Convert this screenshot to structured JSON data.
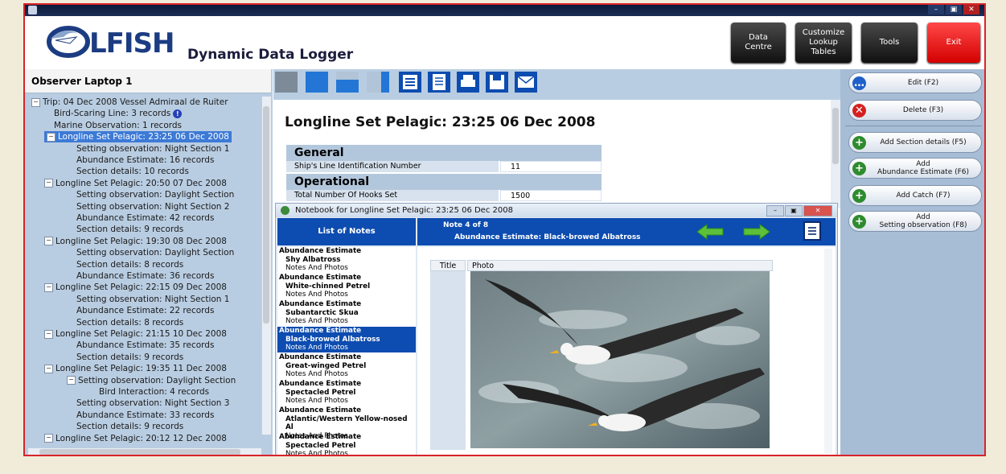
{
  "app": {
    "logo_text": "LFISH",
    "subtitle": "Dynamic Data Logger"
  },
  "header_buttons": [
    {
      "label": "Data\nCentre"
    },
    {
      "label": "Customize\nLookup\nTables"
    },
    {
      "label": "Tools"
    },
    {
      "label": "Exit"
    }
  ],
  "left_panel": {
    "title": "Observer Laptop 1",
    "tree": [
      {
        "text": "Trip: 04 Dec 2008 Vessel Admiraal de Ruiter",
        "level": 0,
        "expander": "−"
      },
      {
        "text": "Bird-Scaring Line: 3 records",
        "level": 1,
        "alert": "!"
      },
      {
        "text": "Marine Observation: 1 records",
        "level": 1
      },
      {
        "text": "Longline Set Pelagic: 23:25 06 Dec 2008",
        "level": 1,
        "expander": "−",
        "selected": true
      },
      {
        "text": "Setting observation: Night Section 1",
        "level": 2
      },
      {
        "text": "Abundance Estimate: 16 records",
        "level": 2
      },
      {
        "text": "Section details: 10 records",
        "level": 2
      },
      {
        "text": "Longline Set Pelagic: 20:50 07 Dec 2008",
        "level": 1,
        "expander": "−"
      },
      {
        "text": "Setting observation: Daylight Section",
        "level": 2
      },
      {
        "text": "Setting observation: Night Section 2",
        "level": 2
      },
      {
        "text": "Abundance Estimate: 42 records",
        "level": 2
      },
      {
        "text": "Section details: 9 records",
        "level": 2
      },
      {
        "text": "Longline Set Pelagic: 19:30 08 Dec 2008",
        "level": 1,
        "expander": "−"
      },
      {
        "text": "Setting observation: Daylight Section",
        "level": 2
      },
      {
        "text": "Section details: 8 records",
        "level": 2
      },
      {
        "text": "Abundance Estimate: 36 records",
        "level": 2
      },
      {
        "text": "Longline Set Pelagic: 22:15 09 Dec 2008",
        "level": 1,
        "expander": "−"
      },
      {
        "text": "Setting observation: Night Section 1",
        "level": 2
      },
      {
        "text": "Abundance Estimate: 22 records",
        "level": 2
      },
      {
        "text": "Section details: 8 records",
        "level": 2
      },
      {
        "text": "Longline Set Pelagic: 21:15 10 Dec 2008",
        "level": 1,
        "expander": "−"
      },
      {
        "text": "Abundance Estimate: 35 records",
        "level": 2
      },
      {
        "text": "Section details: 9 records",
        "level": 2
      },
      {
        "text": "Longline Set Pelagic: 19:35 11 Dec 2008",
        "level": 1,
        "expander": "−"
      },
      {
        "text": "Setting observation: Daylight Section",
        "level": 2,
        "expander": "−"
      },
      {
        "text": "Bird Interaction: 4 records",
        "level": 3
      },
      {
        "text": "Setting observation: Night Section 3",
        "level": 2
      },
      {
        "text": "Abundance Estimate: 33 records",
        "level": 2
      },
      {
        "text": "Section details: 9 records",
        "level": 2
      },
      {
        "text": "Longline Set Pelagic: 20:12 12 Dec 2008",
        "level": 1,
        "expander": "−"
      }
    ]
  },
  "detail": {
    "title": "Longline Set Pelagic: 23:25 06 Dec 2008",
    "general_label": "General",
    "operational_label": "Operational",
    "fields": [
      {
        "label": "Ship's Line Identification Number",
        "value": "11"
      },
      {
        "label": "Total Number Of Hooks Set",
        "value": "1500"
      }
    ]
  },
  "notebook": {
    "title": "Notebook for Longline Set Pelagic: 23:25 06 Dec 2008",
    "list_header": "List of Notes",
    "note_num": "Note 4 of 8",
    "note_title": "Abundance Estimate: Black-browed Albatross",
    "col_title": "Title",
    "col_photo": "Photo",
    "notes": [
      {
        "type": "Abundance Estimate",
        "species": "Shy Albatross",
        "sub": "Notes And Photos"
      },
      {
        "type": "Abundance Estimate",
        "species": "White-chinned Petrel",
        "sub": "Notes And Photos"
      },
      {
        "type": "Abundance Estimate",
        "species": "Subantarctic Skua",
        "sub": "Notes And Photos"
      },
      {
        "type": "Abundance Estimate",
        "species": "Black-browed Albatross",
        "sub": "Notes And Photos",
        "selected": true
      },
      {
        "type": "Abundance Estimate",
        "species": "Great-winged Petrel",
        "sub": "Notes And Photos"
      },
      {
        "type": "Abundance Estimate",
        "species": "Spectacled Petrel",
        "sub": "Notes And Photos"
      },
      {
        "type": "Abundance Estimate",
        "species": "Atlantic/Western Yellow-nosed Al",
        "sub": "Notes And Photos"
      },
      {
        "type": "Abundance Estimate",
        "species": "Spectacled Petrel",
        "sub": "Notes And Photos"
      }
    ]
  },
  "right_panel": {
    "buttons": [
      {
        "label": "Edit (F2)",
        "icon": "ellipsis-icon",
        "color": "#1f5fc8",
        "glyph": "…"
      },
      {
        "label": "Delete (F3)",
        "icon": "delete-icon",
        "color": "#d42020",
        "glyph": "✕"
      },
      {
        "label": "Add Section details (F5)",
        "icon": "add-icon",
        "color": "#2e8b2e",
        "glyph": "+"
      },
      {
        "label": "Add\nAbundance Estimate (F6)",
        "icon": "add-icon",
        "color": "#2e8b2e",
        "glyph": "+"
      },
      {
        "label": "Add Catch (F7)",
        "icon": "add-icon",
        "color": "#2e8b2e",
        "glyph": "+"
      },
      {
        "label": "Add\nSetting observation (F8)",
        "icon": "add-icon",
        "color": "#2e8b2e",
        "glyph": "+"
      }
    ]
  },
  "window_controls": {
    "minimize": "–",
    "maximize": "▣",
    "close": "✕"
  },
  "colors": {
    "selection": "#3c7ad6",
    "header_blue": "#0d4cb0",
    "panel_bg": "#b9cde2",
    "frame_red": "#d8232a"
  }
}
